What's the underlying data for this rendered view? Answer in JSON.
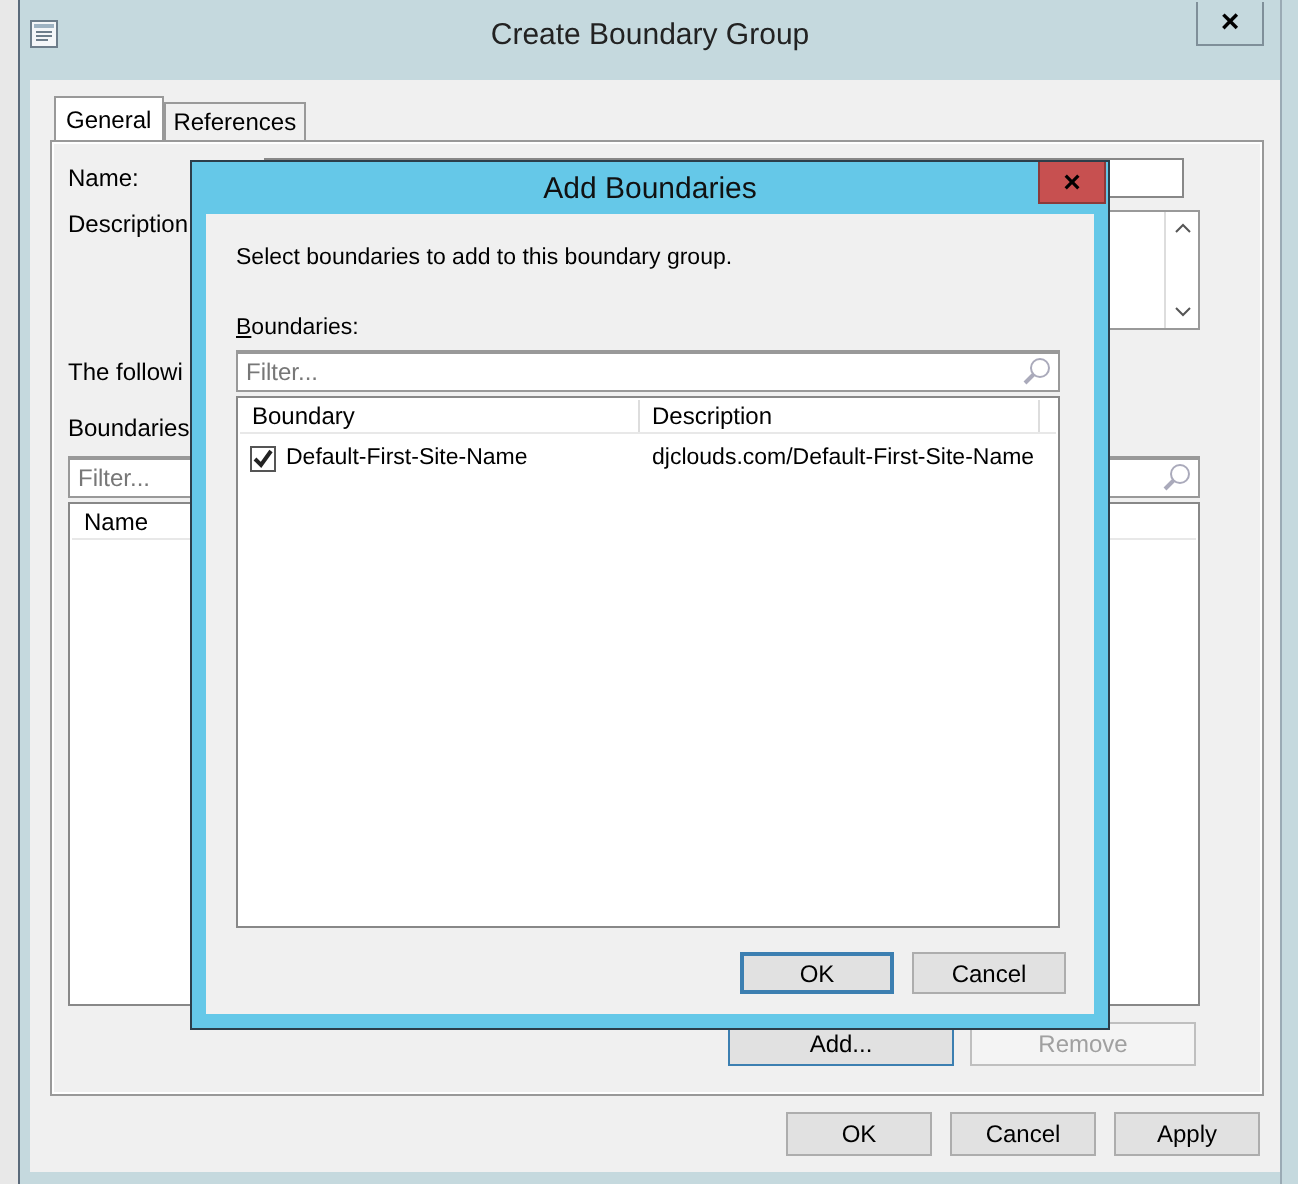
{
  "window": {
    "title": "Create Boundary Group",
    "close": "×"
  },
  "tabs": [
    {
      "label": "General",
      "selected": true
    },
    {
      "label": "References",
      "selected": false
    }
  ],
  "form": {
    "name_label": "Name:",
    "description_label": "Description",
    "following_text": "The followi",
    "boundaries_label": "Boundaries",
    "filter_placeholder": "Filter...",
    "columns": [
      "Name"
    ],
    "buttons": [
      {
        "label": "Add...",
        "disabled": false
      },
      {
        "label": "Remove",
        "disabled": true
      }
    ]
  },
  "buttons": [
    {
      "label": "OK",
      "disabled": false
    },
    {
      "label": "Cancel",
      "disabled": false
    },
    {
      "label": "Apply",
      "disabled": false
    }
  ],
  "dialog": {
    "title": "Add Boundaries",
    "close": "×",
    "instruction": "Select boundaries to add to this boundary group.",
    "list_label": "Boundaries:",
    "filter_placeholder": "Filter...",
    "columns": [
      "Boundary",
      "Description"
    ],
    "rows": [
      {
        "boundary": "Default-First-Site-Name",
        "description": "djclouds.com/Default-First-Site-Name",
        "checked": true
      }
    ],
    "buttons": [
      {
        "label": "OK",
        "default": true
      },
      {
        "label": "Cancel",
        "default": false
      }
    ]
  }
}
